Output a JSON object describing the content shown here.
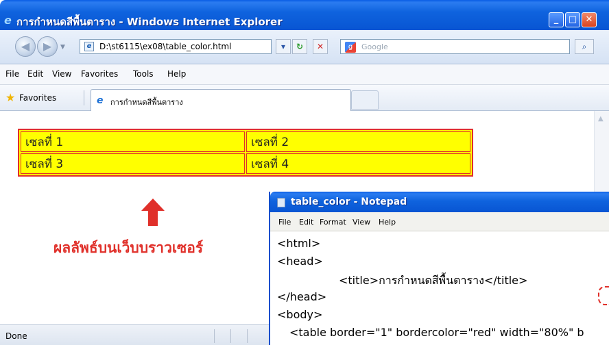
{
  "browser": {
    "window_title": "การกำหนดสีพื้นตาราง - Windows Internet Explorer",
    "address": "D:\\st6115\\ex08\\table_color.html",
    "search_placeholder": "Google",
    "menu": [
      "File",
      "Edit",
      "View",
      "Favorites",
      "Tools",
      "Help"
    ],
    "favorites_label": "Favorites",
    "tab_title": "การกำหนดสีพื้นตาราง",
    "status": "Done"
  },
  "page": {
    "table": [
      [
        "เซลที่ 1",
        "เซลที่ 2"
      ],
      [
        "เซลที่ 3",
        "เซลที่ 4"
      ]
    ],
    "table_color": "#ffff00",
    "border_color": "#e0302a",
    "annotation": "ผลลัพธ์บนเว็บบราวเซอร์"
  },
  "notepad": {
    "title": "table_color - Notepad",
    "menu": [
      "File",
      "Edit",
      "Format",
      "View",
      "Help"
    ],
    "lines": [
      "<html>",
      "<head>",
      "<title>การกำหนดสีพื้นตาราง</title>",
      "</head>",
      "<body>",
      "<table border=\"1\" bordercolor=\"red\" width=\"80%\" b"
    ]
  }
}
